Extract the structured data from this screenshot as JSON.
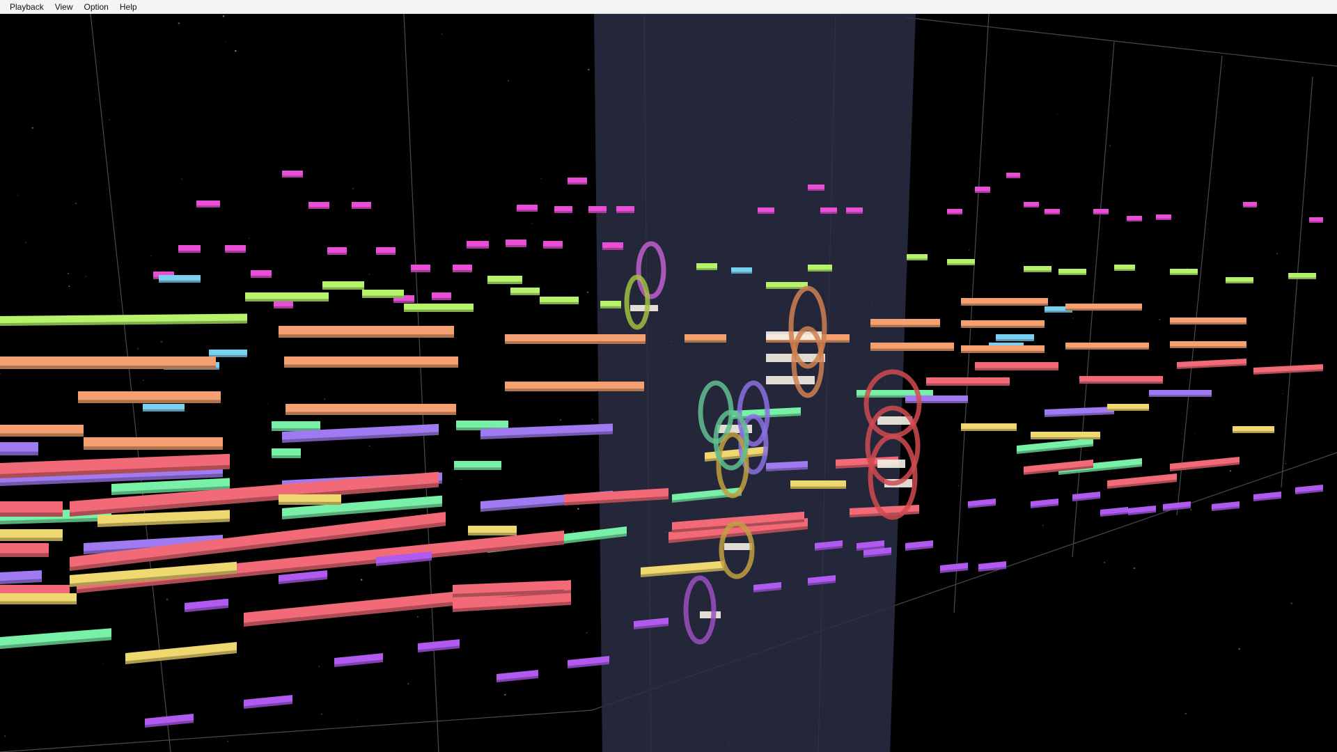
{
  "menu": {
    "items": [
      {
        "label": "Playback"
      },
      {
        "label": "View"
      },
      {
        "label": "Option"
      },
      {
        "label": "Help"
      }
    ]
  },
  "visualizer": {
    "background": "#000000",
    "playhead_color": "#2a2d44",
    "grid_color": "#4a4a4a",
    "palette": {
      "pink": "#e94fd6",
      "lime": "#b6f26a",
      "orange": "#f4a070",
      "cyan": "#7ad0f0",
      "violet": "#a07af0",
      "salmon": "#f26a78",
      "mint": "#78f0a8",
      "yellow": "#f0d870",
      "purple": "#b05af0"
    },
    "ring_colors": [
      "#c060d0",
      "#a0c040",
      "#d08050",
      "#60c090",
      "#8a70e0",
      "#d04a50",
      "#c0a040",
      "#9a50c0"
    ]
  }
}
